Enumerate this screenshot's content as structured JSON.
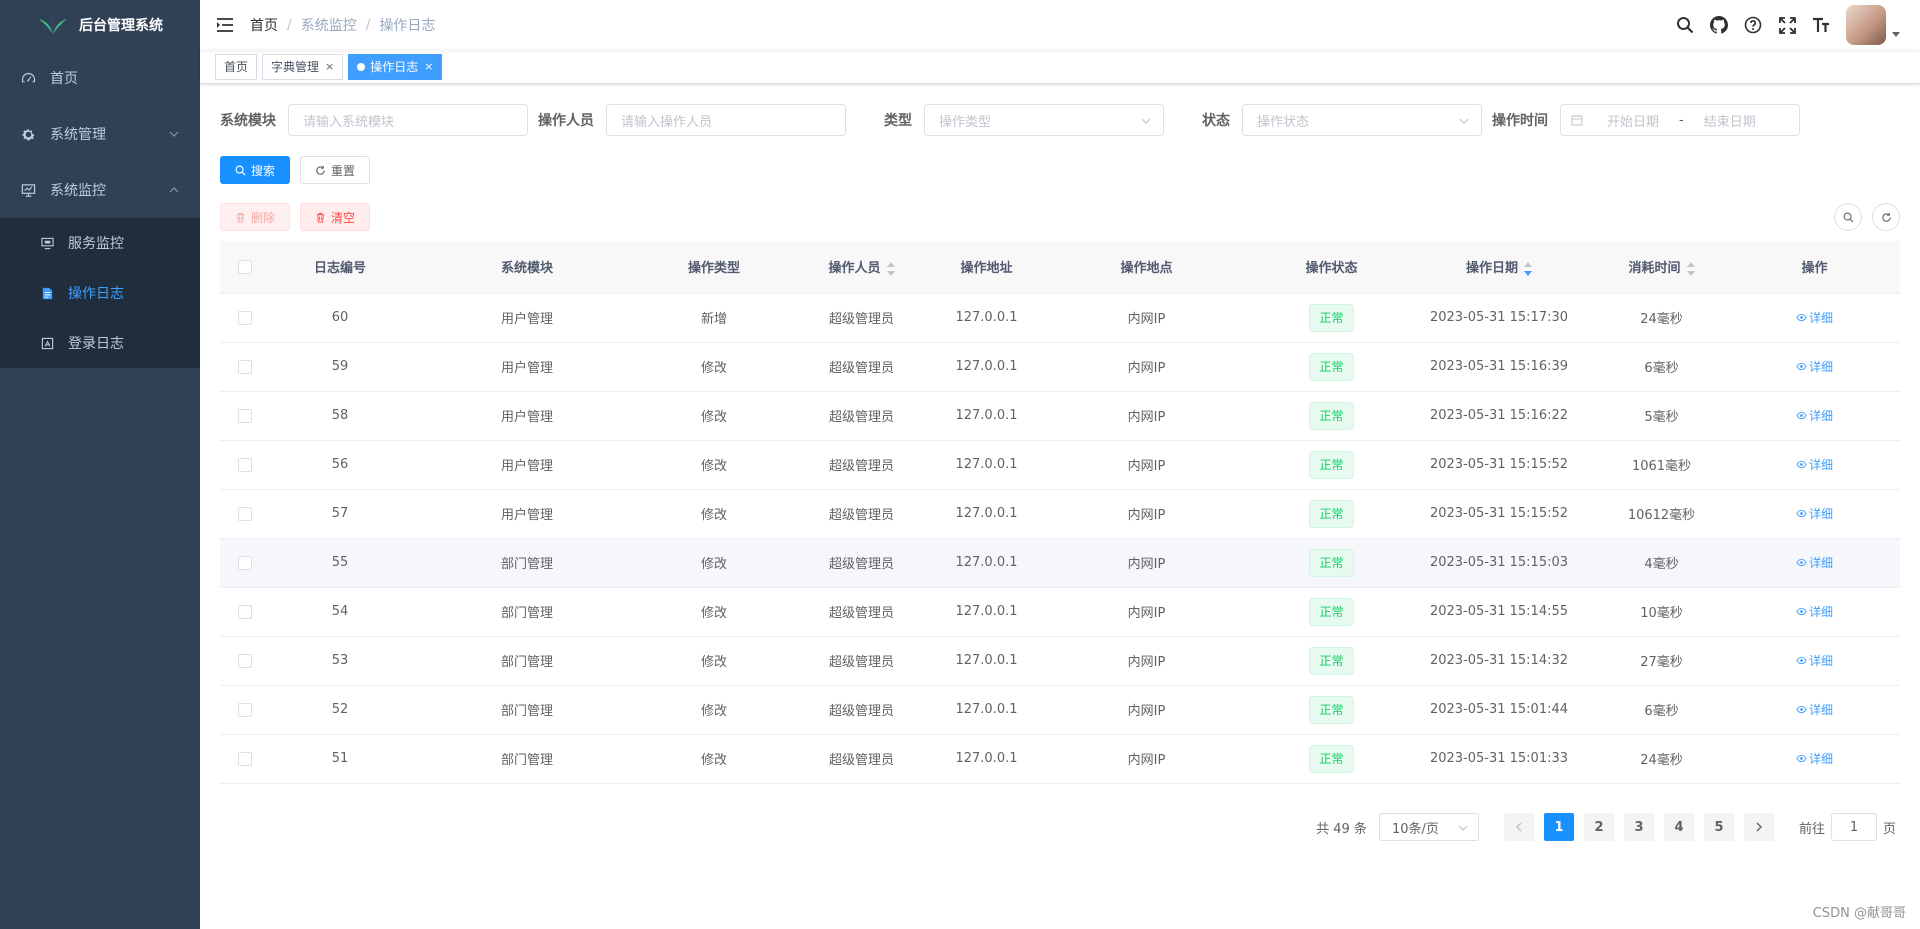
{
  "app": {
    "title": "后台管理系统"
  },
  "sidebar": {
    "items": [
      {
        "label": "首页",
        "icon": "dashboard-icon"
      },
      {
        "label": "系统管理",
        "icon": "gear-icon",
        "expanded": false
      },
      {
        "label": "系统监控",
        "icon": "monitor-icon",
        "expanded": true
      }
    ],
    "monitor_children": [
      {
        "label": "服务监控",
        "icon": "server-icon",
        "active": false
      },
      {
        "label": "操作日志",
        "icon": "form-icon",
        "active": true
      },
      {
        "label": "登录日志",
        "icon": "logininfor-icon",
        "active": false
      }
    ]
  },
  "breadcrumb": {
    "items": [
      "首页",
      "系统监控",
      "操作日志"
    ],
    "separator": "/"
  },
  "tags": [
    {
      "label": "首页",
      "closable": false,
      "active": false
    },
    {
      "label": "字典管理",
      "closable": true,
      "active": false
    },
    {
      "label": "操作日志",
      "closable": true,
      "active": true
    }
  ],
  "tag_close": "×",
  "filters": {
    "module": {
      "label": "系统模块",
      "placeholder": "请输入系统模块"
    },
    "operator": {
      "label": "操作人员",
      "placeholder": "请输入操作人员"
    },
    "type": {
      "label": "类型",
      "placeholder": "操作类型"
    },
    "status": {
      "label": "状态",
      "placeholder": "操作状态"
    },
    "time": {
      "label": "操作时间",
      "start_placeholder": "开始日期",
      "end_placeholder": "结束日期",
      "separator": "-"
    }
  },
  "buttons": {
    "search": "搜索",
    "reset": "重置",
    "delete": "删除",
    "clear": "清空"
  },
  "table": {
    "headers": [
      "日志编号",
      "系统模块",
      "操作类型",
      "操作人员",
      "操作地址",
      "操作地点",
      "操作状态",
      "操作日期",
      "消耗时间",
      "操作"
    ],
    "detail_label": "详细",
    "rows": [
      {
        "id": "60",
        "module": "用户管理",
        "type": "新增",
        "operator": "超级管理员",
        "ip": "127.0.0.1",
        "location": "内网IP",
        "status": "正常",
        "time": "2023-05-31 15:17:30",
        "cost": "24毫秒"
      },
      {
        "id": "59",
        "module": "用户管理",
        "type": "修改",
        "operator": "超级管理员",
        "ip": "127.0.0.1",
        "location": "内网IP",
        "status": "正常",
        "time": "2023-05-31 15:16:39",
        "cost": "6毫秒"
      },
      {
        "id": "58",
        "module": "用户管理",
        "type": "修改",
        "operator": "超级管理员",
        "ip": "127.0.0.1",
        "location": "内网IP",
        "status": "正常",
        "time": "2023-05-31 15:16:22",
        "cost": "5毫秒"
      },
      {
        "id": "56",
        "module": "用户管理",
        "type": "修改",
        "operator": "超级管理员",
        "ip": "127.0.0.1",
        "location": "内网IP",
        "status": "正常",
        "time": "2023-05-31 15:15:52",
        "cost": "1061毫秒"
      },
      {
        "id": "57",
        "module": "用户管理",
        "type": "修改",
        "operator": "超级管理员",
        "ip": "127.0.0.1",
        "location": "内网IP",
        "status": "正常",
        "time": "2023-05-31 15:15:52",
        "cost": "10612毫秒"
      },
      {
        "id": "55",
        "module": "部门管理",
        "type": "修改",
        "operator": "超级管理员",
        "ip": "127.0.0.1",
        "location": "内网IP",
        "status": "正常",
        "time": "2023-05-31 15:15:03",
        "cost": "4毫秒"
      },
      {
        "id": "54",
        "module": "部门管理",
        "type": "修改",
        "operator": "超级管理员",
        "ip": "127.0.0.1",
        "location": "内网IP",
        "status": "正常",
        "time": "2023-05-31 15:14:55",
        "cost": "10毫秒"
      },
      {
        "id": "53",
        "module": "部门管理",
        "type": "修改",
        "operator": "超级管理员",
        "ip": "127.0.0.1",
        "location": "内网IP",
        "status": "正常",
        "time": "2023-05-31 15:14:32",
        "cost": "27毫秒"
      },
      {
        "id": "52",
        "module": "部门管理",
        "type": "修改",
        "operator": "超级管理员",
        "ip": "127.0.0.1",
        "location": "内网IP",
        "status": "正常",
        "time": "2023-05-31 15:01:44",
        "cost": "6毫秒"
      },
      {
        "id": "51",
        "module": "部门管理",
        "type": "修改",
        "operator": "超级管理员",
        "ip": "127.0.0.1",
        "location": "内网IP",
        "status": "正常",
        "time": "2023-05-31 15:01:33",
        "cost": "24毫秒"
      }
    ]
  },
  "pagination": {
    "total": "共 49 条",
    "page_size": "10条/页",
    "pages": [
      "1",
      "2",
      "3",
      "4",
      "5"
    ],
    "current": "1",
    "goto_prefix": "前往",
    "goto_value": "1",
    "goto_suffix": "页"
  },
  "watermark": "CSDN @献哥哥",
  "colors": {
    "sidebar_bg": "#304156",
    "submenu_bg": "#1f2d3d",
    "primary": "#1890ff",
    "success": "#13ce66",
    "danger": "#ff4949"
  }
}
